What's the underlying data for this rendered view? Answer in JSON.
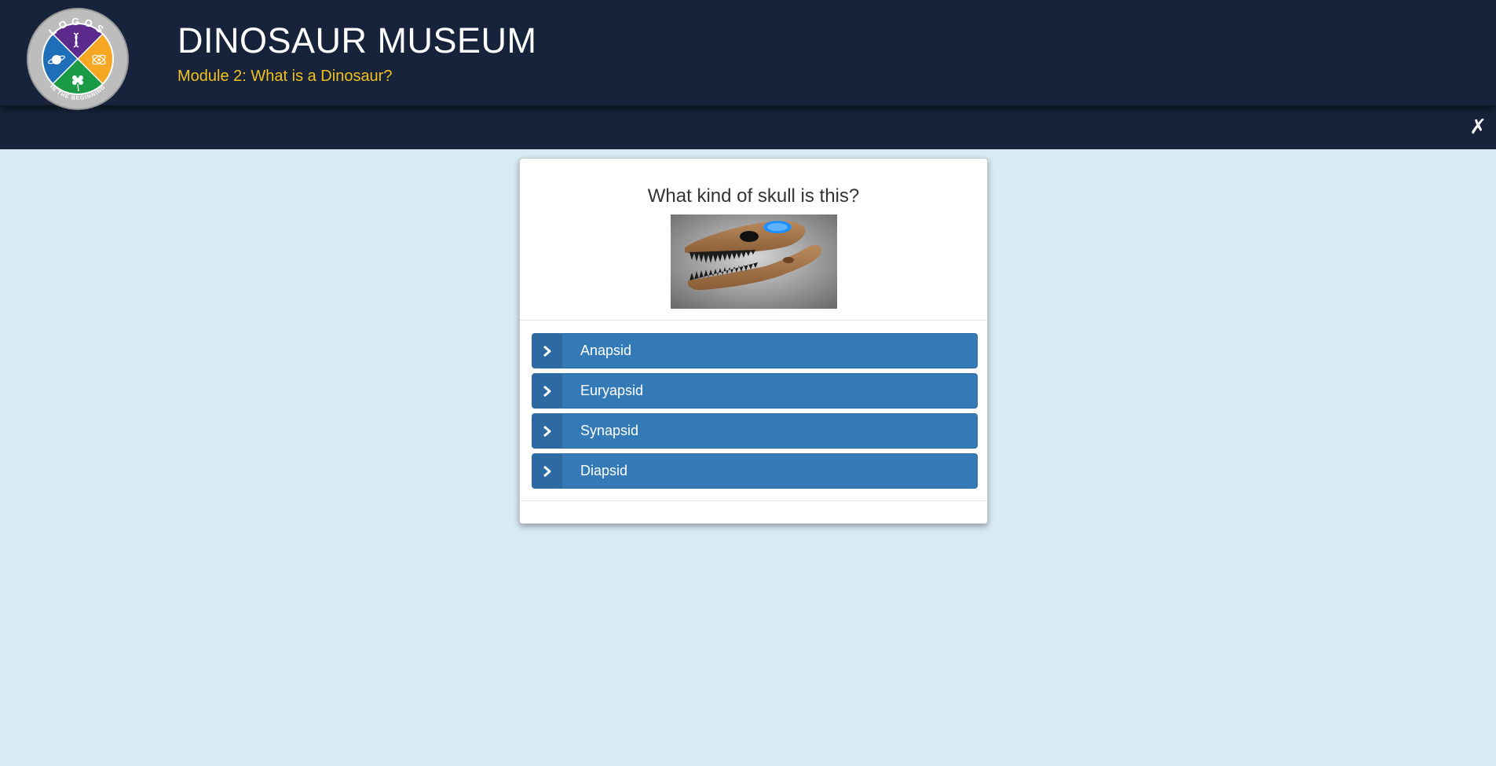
{
  "header": {
    "title": "DINOSAUR MUSEUM",
    "subtitle": "Module 2: What is a Dinosaur?",
    "logo": {
      "top_text": "LOGOS",
      "bottom_text": "IN THE BEGINNING",
      "icon_name": "logos-emblem-icon"
    },
    "close_label": "✗"
  },
  "quiz": {
    "question": "What kind of skull is this?",
    "image_icon": "dinosaur-skull-image",
    "answers": [
      {
        "label": "Anapsid"
      },
      {
        "label": "Euryapsid"
      },
      {
        "label": "Synapsid"
      },
      {
        "label": "Diapsid"
      }
    ]
  },
  "colors": {
    "header_bg": "#16233a",
    "subtitle": "#f2c21b",
    "page_bg": "#d8ebf5",
    "answer_bg": "#337ab7",
    "answer_icon_bg": "#2d6aa1"
  }
}
